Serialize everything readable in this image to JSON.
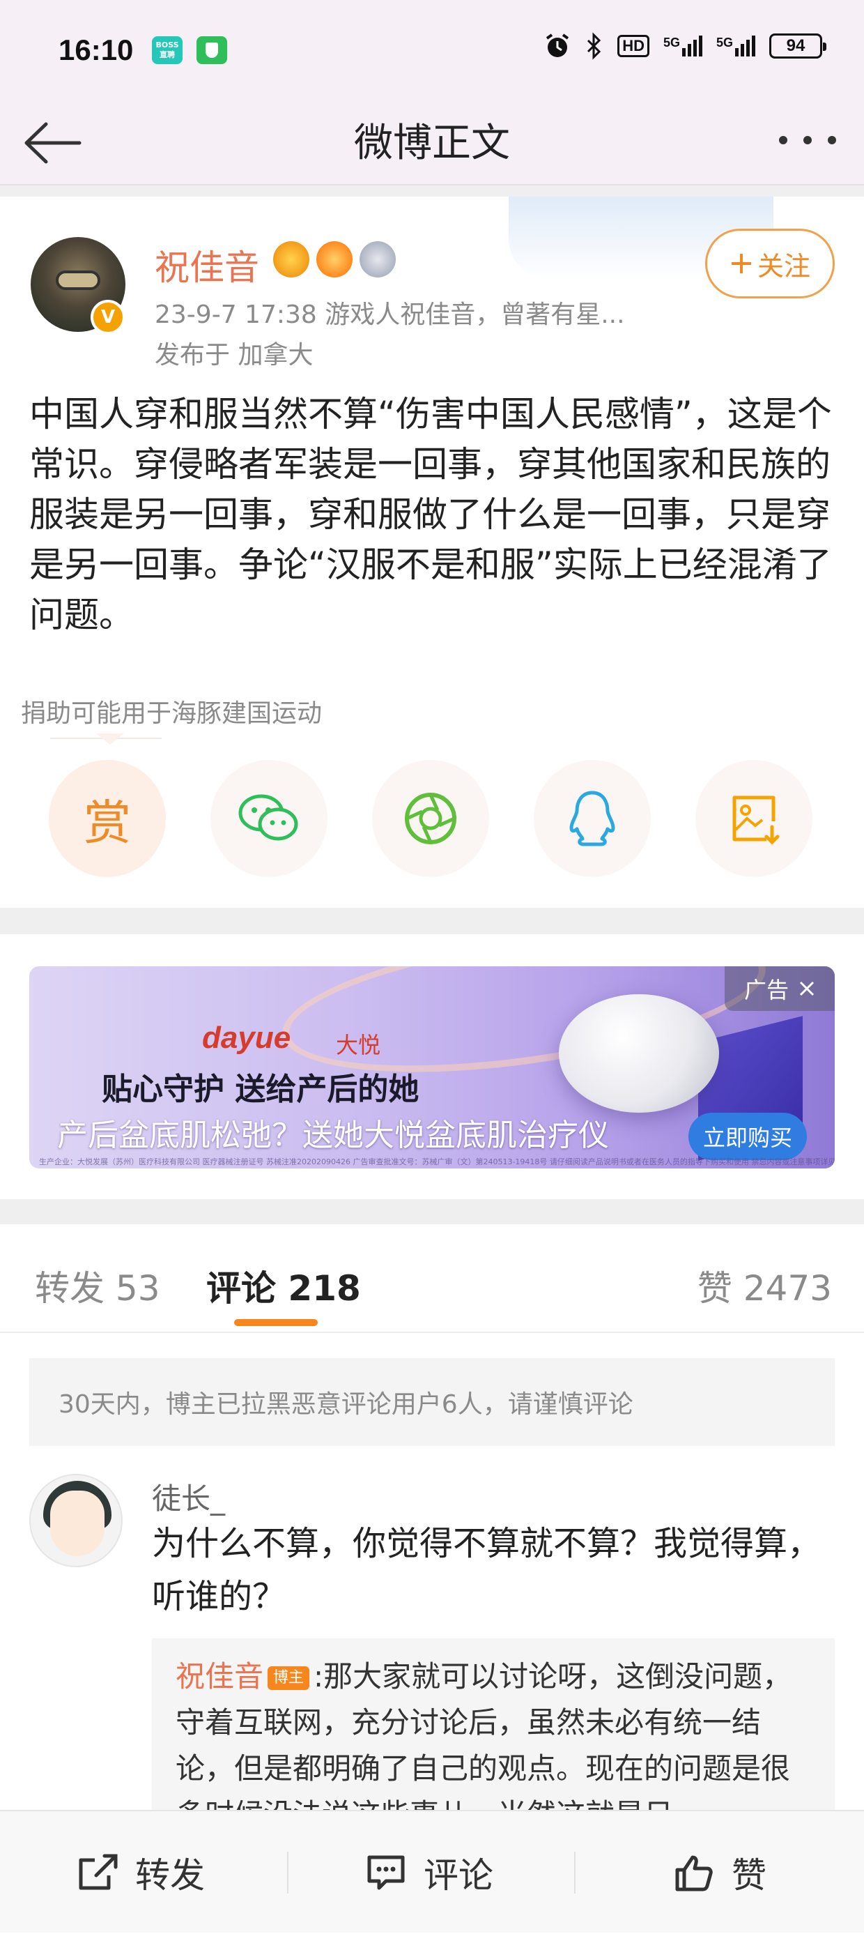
{
  "status": {
    "time": "16:10",
    "app1_label": "BOSS直聘",
    "hd": "HD",
    "net1": "5G",
    "net2": "5G",
    "battery": "94"
  },
  "nav": {
    "title": "微博正文"
  },
  "post": {
    "author": "祝佳音",
    "verified_mark": "V",
    "follow_label": "关注",
    "meta": "23-9-7 17:38  游戏人祝佳音，曾著有星...",
    "location": "发布于 加拿大",
    "text": "中国人穿和服当然不算“伤害中国人民感情”，这是个常识。穿侵略者军装是一回事，穿其他国家和民族的服装是另一回事，穿和服做了什么是一回事，只是穿是另一回事。争论“汉服不是和服”实际上已经混淆了问题。",
    "donate_note": "捐助可能用于海豚建国运动",
    "reward_label": "赏",
    "share_icons": [
      "reward-icon",
      "wechat-icon",
      "moments-icon",
      "qq-icon",
      "save-image-icon"
    ]
  },
  "ad": {
    "tag": "广告",
    "brand": "dayue",
    "brand_cn": "大悦",
    "slogan": "贴心守护  送给产后的她",
    "line": "产后盆底肌松弛？送她大悦盆底肌治疗仪",
    "button": "立即购买",
    "fine_print": "生产企业：大悦发展（苏州）医疗科技有限公司  医疗器械注册证号  苏械注准20202090426  广告审查批准文号：苏械广审（文）第240513-19418号  请仔细阅读产品说明书或者在医务人员的指导下购买和使用  禁忌内容或注意事项详见说明书"
  },
  "tabs": {
    "repost_label": "转发",
    "repost_count": "53",
    "comment_label": "评论",
    "comment_count": "218",
    "like_label": "赞",
    "like_count": "2473"
  },
  "notice": "30天内，博主已拉黑恶意评论用户6人，请谨慎评论",
  "comment": {
    "user": "徒长_",
    "text": "为什么不算，你觉得不算就不算？我觉得算，听谁的？",
    "reply_user": "祝佳音",
    "reply_badge": "博主",
    "reply_text": ":那大家就可以讨论呀，这倒没问题，守着互联网，充分讨论后，虽然未必有统一结论，但是都明确了自己的观点。现在的问题是很多时候没法说这些事儿，当然这就是日"
  },
  "bottom": {
    "repost": "转发",
    "comment": "评论",
    "like": "赞"
  },
  "colors": {
    "accent": "#f7861c",
    "name_orange": "#eb7350",
    "follow_orange": "#f08a24",
    "ad_button": "#2f7de1"
  }
}
